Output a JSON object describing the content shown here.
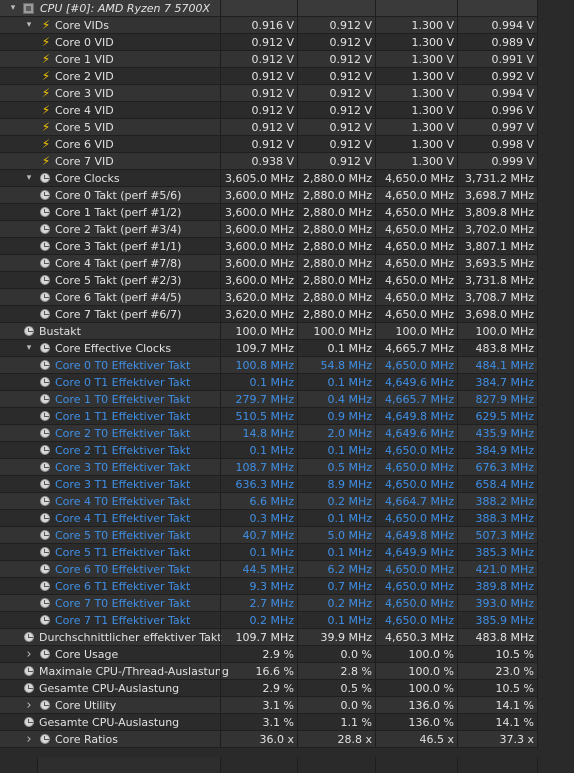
{
  "header": {
    "title": "CPU [#0]: AMD Ryzen 7 5700X",
    "icon": "cpu-icon"
  },
  "colors": {
    "effective_per_thread": "#3f8fe6",
    "bolt": "#f2c200"
  },
  "rows": [
    {
      "label": "Core VIDs",
      "icon": "bolt-icon",
      "level": 1,
      "chevron": "down",
      "blue": false,
      "v": [
        "0.916 V",
        "0.912 V",
        "1.300 V",
        "0.994 V"
      ]
    },
    {
      "label": "Core 0 VID",
      "icon": "bolt-icon",
      "level": 2,
      "chevron": "",
      "blue": false,
      "v": [
        "0.912 V",
        "0.912 V",
        "1.300 V",
        "0.989 V"
      ]
    },
    {
      "label": "Core 1 VID",
      "icon": "bolt-icon",
      "level": 2,
      "chevron": "",
      "blue": false,
      "v": [
        "0.912 V",
        "0.912 V",
        "1.300 V",
        "0.991 V"
      ]
    },
    {
      "label": "Core 2 VID",
      "icon": "bolt-icon",
      "level": 2,
      "chevron": "",
      "blue": false,
      "v": [
        "0.912 V",
        "0.912 V",
        "1.300 V",
        "0.992 V"
      ]
    },
    {
      "label": "Core 3 VID",
      "icon": "bolt-icon",
      "level": 2,
      "chevron": "",
      "blue": false,
      "v": [
        "0.912 V",
        "0.912 V",
        "1.300 V",
        "0.994 V"
      ]
    },
    {
      "label": "Core 4 VID",
      "icon": "bolt-icon",
      "level": 2,
      "chevron": "",
      "blue": false,
      "v": [
        "0.912 V",
        "0.912 V",
        "1.300 V",
        "0.996 V"
      ]
    },
    {
      "label": "Core 5 VID",
      "icon": "bolt-icon",
      "level": 2,
      "chevron": "",
      "blue": false,
      "v": [
        "0.912 V",
        "0.912 V",
        "1.300 V",
        "0.997 V"
      ]
    },
    {
      "label": "Core 6 VID",
      "icon": "bolt-icon",
      "level": 2,
      "chevron": "",
      "blue": false,
      "v": [
        "0.912 V",
        "0.912 V",
        "1.300 V",
        "0.998 V"
      ]
    },
    {
      "label": "Core 7 VID",
      "icon": "bolt-icon",
      "level": 2,
      "chevron": "",
      "blue": false,
      "v": [
        "0.938 V",
        "0.912 V",
        "1.300 V",
        "0.999 V"
      ]
    },
    {
      "label": "Core Clocks",
      "icon": "clock-icon",
      "level": 1,
      "chevron": "down",
      "blue": false,
      "v": [
        "3,605.0 MHz",
        "2,880.0 MHz",
        "4,650.0 MHz",
        "3,731.2 MHz"
      ]
    },
    {
      "label": "Core 0 Takt (perf #5/6)",
      "icon": "clock-icon",
      "level": 2,
      "chevron": "",
      "blue": false,
      "v": [
        "3,600.0 MHz",
        "2,880.0 MHz",
        "4,650.0 MHz",
        "3,698.7 MHz"
      ]
    },
    {
      "label": "Core 1 Takt (perf #1/2)",
      "icon": "clock-icon",
      "level": 2,
      "chevron": "",
      "blue": false,
      "v": [
        "3,600.0 MHz",
        "2,880.0 MHz",
        "4,650.0 MHz",
        "3,809.8 MHz"
      ]
    },
    {
      "label": "Core 2 Takt (perf #3/4)",
      "icon": "clock-icon",
      "level": 2,
      "chevron": "",
      "blue": false,
      "v": [
        "3,600.0 MHz",
        "2,880.0 MHz",
        "4,650.0 MHz",
        "3,702.0 MHz"
      ]
    },
    {
      "label": "Core 3 Takt (perf #1/1)",
      "icon": "clock-icon",
      "level": 2,
      "chevron": "",
      "blue": false,
      "v": [
        "3,600.0 MHz",
        "2,880.0 MHz",
        "4,650.0 MHz",
        "3,807.1 MHz"
      ]
    },
    {
      "label": "Core 4 Takt (perf #7/8)",
      "icon": "clock-icon",
      "level": 2,
      "chevron": "",
      "blue": false,
      "v": [
        "3,600.0 MHz",
        "2,880.0 MHz",
        "4,650.0 MHz",
        "3,693.5 MHz"
      ]
    },
    {
      "label": "Core 5 Takt (perf #2/3)",
      "icon": "clock-icon",
      "level": 2,
      "chevron": "",
      "blue": false,
      "v": [
        "3,600.0 MHz",
        "2,880.0 MHz",
        "4,650.0 MHz",
        "3,731.8 MHz"
      ]
    },
    {
      "label": "Core 6 Takt (perf #4/5)",
      "icon": "clock-icon",
      "level": 2,
      "chevron": "",
      "blue": false,
      "v": [
        "3,620.0 MHz",
        "2,880.0 MHz",
        "4,650.0 MHz",
        "3,708.7 MHz"
      ]
    },
    {
      "label": "Core 7 Takt (perf #6/7)",
      "icon": "clock-icon",
      "level": 2,
      "chevron": "",
      "blue": false,
      "v": [
        "3,620.0 MHz",
        "2,880.0 MHz",
        "4,650.0 MHz",
        "3,698.0 MHz"
      ]
    },
    {
      "label": "Bustakt",
      "icon": "clock-icon",
      "level": 0,
      "chevron": "",
      "blue": false,
      "v": [
        "100.0 MHz",
        "100.0 MHz",
        "100.0 MHz",
        "100.0 MHz"
      ]
    },
    {
      "label": "Core Effective Clocks",
      "icon": "clock-icon",
      "level": 1,
      "chevron": "down",
      "blue": false,
      "v": [
        "109.7 MHz",
        "0.1 MHz",
        "4,665.7 MHz",
        "483.8 MHz"
      ]
    },
    {
      "label": "Core 0 T0 Effektiver Takt",
      "icon": "clock-icon",
      "level": 2,
      "chevron": "",
      "blue": true,
      "v": [
        "100.8 MHz",
        "54.8 MHz",
        "4,650.0 MHz",
        "484.1 MHz"
      ]
    },
    {
      "label": "Core 0 T1 Effektiver Takt",
      "icon": "clock-icon",
      "level": 2,
      "chevron": "",
      "blue": true,
      "v": [
        "0.1 MHz",
        "0.1 MHz",
        "4,649.6 MHz",
        "384.7 MHz"
      ]
    },
    {
      "label": "Core 1 T0 Effektiver Takt",
      "icon": "clock-icon",
      "level": 2,
      "chevron": "",
      "blue": true,
      "v": [
        "279.7 MHz",
        "0.4 MHz",
        "4,665.7 MHz",
        "827.9 MHz"
      ]
    },
    {
      "label": "Core 1 T1 Effektiver Takt",
      "icon": "clock-icon",
      "level": 2,
      "chevron": "",
      "blue": true,
      "v": [
        "510.5 MHz",
        "0.9 MHz",
        "4,649.8 MHz",
        "629.5 MHz"
      ]
    },
    {
      "label": "Core 2 T0 Effektiver Takt",
      "icon": "clock-icon",
      "level": 2,
      "chevron": "",
      "blue": true,
      "v": [
        "14.8 MHz",
        "2.0 MHz",
        "4,649.6 MHz",
        "435.9 MHz"
      ]
    },
    {
      "label": "Core 2 T1 Effektiver Takt",
      "icon": "clock-icon",
      "level": 2,
      "chevron": "",
      "blue": true,
      "v": [
        "0.1 MHz",
        "0.1 MHz",
        "4,650.0 MHz",
        "384.9 MHz"
      ]
    },
    {
      "label": "Core 3 T0 Effektiver Takt",
      "icon": "clock-icon",
      "level": 2,
      "chevron": "",
      "blue": true,
      "v": [
        "108.7 MHz",
        "0.5 MHz",
        "4,650.0 MHz",
        "676.3 MHz"
      ]
    },
    {
      "label": "Core 3 T1 Effektiver Takt",
      "icon": "clock-icon",
      "level": 2,
      "chevron": "",
      "blue": true,
      "v": [
        "636.3 MHz",
        "8.9 MHz",
        "4,650.0 MHz",
        "658.4 MHz"
      ]
    },
    {
      "label": "Core 4 T0 Effektiver Takt",
      "icon": "clock-icon",
      "level": 2,
      "chevron": "",
      "blue": true,
      "v": [
        "6.6 MHz",
        "0.2 MHz",
        "4,664.7 MHz",
        "388.2 MHz"
      ]
    },
    {
      "label": "Core 4 T1 Effektiver Takt",
      "icon": "clock-icon",
      "level": 2,
      "chevron": "",
      "blue": true,
      "v": [
        "0.3 MHz",
        "0.1 MHz",
        "4,650.0 MHz",
        "388.3 MHz"
      ]
    },
    {
      "label": "Core 5 T0 Effektiver Takt",
      "icon": "clock-icon",
      "level": 2,
      "chevron": "",
      "blue": true,
      "v": [
        "40.7 MHz",
        "5.0 MHz",
        "4,649.8 MHz",
        "507.3 MHz"
      ]
    },
    {
      "label": "Core 5 T1 Effektiver Takt",
      "icon": "clock-icon",
      "level": 2,
      "chevron": "",
      "blue": true,
      "v": [
        "0.1 MHz",
        "0.1 MHz",
        "4,649.9 MHz",
        "385.3 MHz"
      ]
    },
    {
      "label": "Core 6 T0 Effektiver Takt",
      "icon": "clock-icon",
      "level": 2,
      "chevron": "",
      "blue": true,
      "v": [
        "44.5 MHz",
        "6.2 MHz",
        "4,650.0 MHz",
        "421.0 MHz"
      ]
    },
    {
      "label": "Core 6 T1 Effektiver Takt",
      "icon": "clock-icon",
      "level": 2,
      "chevron": "",
      "blue": true,
      "v": [
        "9.3 MHz",
        "0.7 MHz",
        "4,650.0 MHz",
        "389.8 MHz"
      ]
    },
    {
      "label": "Core 7 T0 Effektiver Takt",
      "icon": "clock-icon",
      "level": 2,
      "chevron": "",
      "blue": true,
      "v": [
        "2.7 MHz",
        "0.2 MHz",
        "4,650.0 MHz",
        "393.0 MHz"
      ]
    },
    {
      "label": "Core 7 T1 Effektiver Takt",
      "icon": "clock-icon",
      "level": 2,
      "chevron": "",
      "blue": true,
      "v": [
        "0.2 MHz",
        "0.1 MHz",
        "4,650.0 MHz",
        "385.9 MHz"
      ]
    },
    {
      "label": "Durchschnittlicher effektiver Takt",
      "icon": "clock-icon",
      "level": 0,
      "chevron": "",
      "blue": false,
      "v": [
        "109.7 MHz",
        "39.9 MHz",
        "4,650.3 MHz",
        "483.8 MHz"
      ]
    },
    {
      "label": "Core Usage",
      "icon": "clock-icon",
      "level": 1,
      "chevron": "right",
      "blue": false,
      "v": [
        "2.9 %",
        "0.0 %",
        "100.0 %",
        "10.5 %"
      ]
    },
    {
      "label": "Maximale CPU-/Thread-Auslastung",
      "icon": "clock-icon",
      "level": 0,
      "chevron": "",
      "blue": false,
      "v": [
        "16.6 %",
        "2.8 %",
        "100.0 %",
        "23.0 %"
      ]
    },
    {
      "label": "Gesamte CPU-Auslastung",
      "icon": "clock-icon",
      "level": 0,
      "chevron": "",
      "blue": false,
      "v": [
        "2.9 %",
        "0.5 %",
        "100.0 %",
        "10.5 %"
      ]
    },
    {
      "label": "Core Utility",
      "icon": "clock-icon",
      "level": 1,
      "chevron": "right",
      "blue": false,
      "v": [
        "3.1 %",
        "0.0 %",
        "136.0 %",
        "14.1 %"
      ]
    },
    {
      "label": "Gesamte CPU-Auslastung",
      "icon": "clock-icon",
      "level": 0,
      "chevron": "",
      "blue": false,
      "v": [
        "3.1 %",
        "1.1 %",
        "136.0 %",
        "14.1 %"
      ]
    },
    {
      "label": "Core Ratios",
      "icon": "clock-icon",
      "level": 1,
      "chevron": "right",
      "blue": false,
      "v": [
        "36.0 x",
        "28.8 x",
        "46.5 x",
        "37.3 x"
      ]
    }
  ]
}
